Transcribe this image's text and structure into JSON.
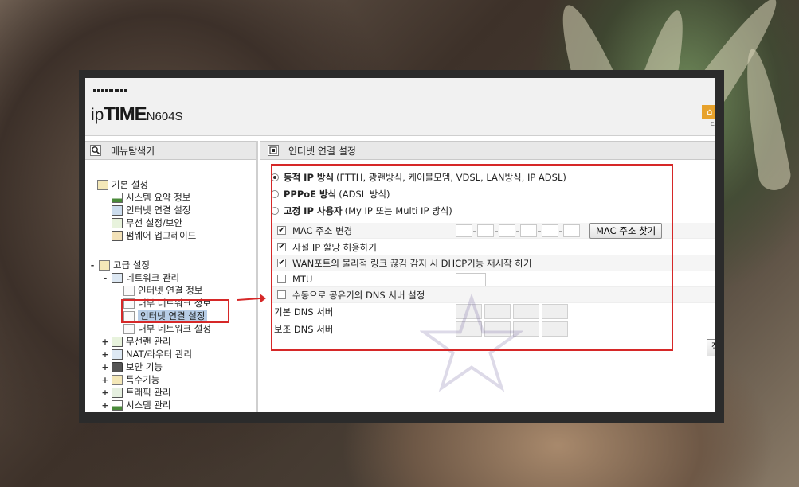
{
  "header": {
    "brand_ip": "ip",
    "brand_time": "TIME",
    "brand_model": "N604S",
    "badge_text": "디"
  },
  "sidebar": {
    "title": "메뉴탐색기",
    "basic": {
      "label": "기본 설정",
      "items": [
        "시스템 요약 정보",
        "인터넷 연결 설정",
        "무선 설정/보안",
        "펌웨어 업그레이드"
      ]
    },
    "advanced": {
      "expander": "-",
      "label": "고급 설정",
      "network": {
        "expander": "-",
        "label": "네트워크 관리",
        "items": [
          "인터넷 연결 정보",
          "내부 네트워크 정보",
          "인터넷 연결 설정",
          "내부 네트워크 설정"
        ],
        "selected_index": 2
      },
      "groups": [
        {
          "expander": "+",
          "label": "무선랜 관리",
          "icon": "wifi-icon"
        },
        {
          "expander": "+",
          "label": "NAT/라우터 관리",
          "icon": "router-icon"
        },
        {
          "expander": "+",
          "label": "보안 기능",
          "icon": "lock-icon"
        },
        {
          "expander": "+",
          "label": "특수기능",
          "icon": "special-icon"
        },
        {
          "expander": "+",
          "label": "트래픽 관리",
          "icon": "traffic-icon"
        },
        {
          "expander": "+",
          "label": "시스템 관리",
          "icon": "system-icon"
        }
      ]
    }
  },
  "main": {
    "title": "인터넷 연결 설정",
    "options": [
      {
        "bold": "동적 IP 방식",
        "detail": "(FTTH, 광랜방식, 케이블모뎀, VDSL, LAN방식, IP ADSL)",
        "selected": true
      },
      {
        "bold": "PPPoE 방식",
        "detail": "(ADSL 방식)",
        "selected": false
      },
      {
        "bold": "고정 IP 사용자",
        "detail": "(My IP 또는 Multi IP 방식)",
        "selected": false
      }
    ],
    "mac_change": {
      "label": "MAC 주소 변경",
      "checked": true,
      "button": "MAC 주소 찾기"
    },
    "private_ip": {
      "label": "사설 IP 할당 허용하기",
      "checked": true
    },
    "dhcp_restart": {
      "label": "WAN포트의 물리적 링크 끊김 감지 시 DHCP기능 재시작 하기",
      "checked": true
    },
    "mtu": {
      "label": "MTU",
      "checked": false
    },
    "manual_dns": {
      "label": "수동으로 공유기의 DNS 서버 설정",
      "checked": false
    },
    "dns_primary": {
      "label": "기본 DNS 서버"
    },
    "dns_secondary": {
      "label": "보조 DNS 서버"
    },
    "apply_button": "적"
  },
  "colors": {
    "annotation_red": "#d62828",
    "selected_highlight": "#b7cde6",
    "panel_header": "#e8e8e8"
  }
}
